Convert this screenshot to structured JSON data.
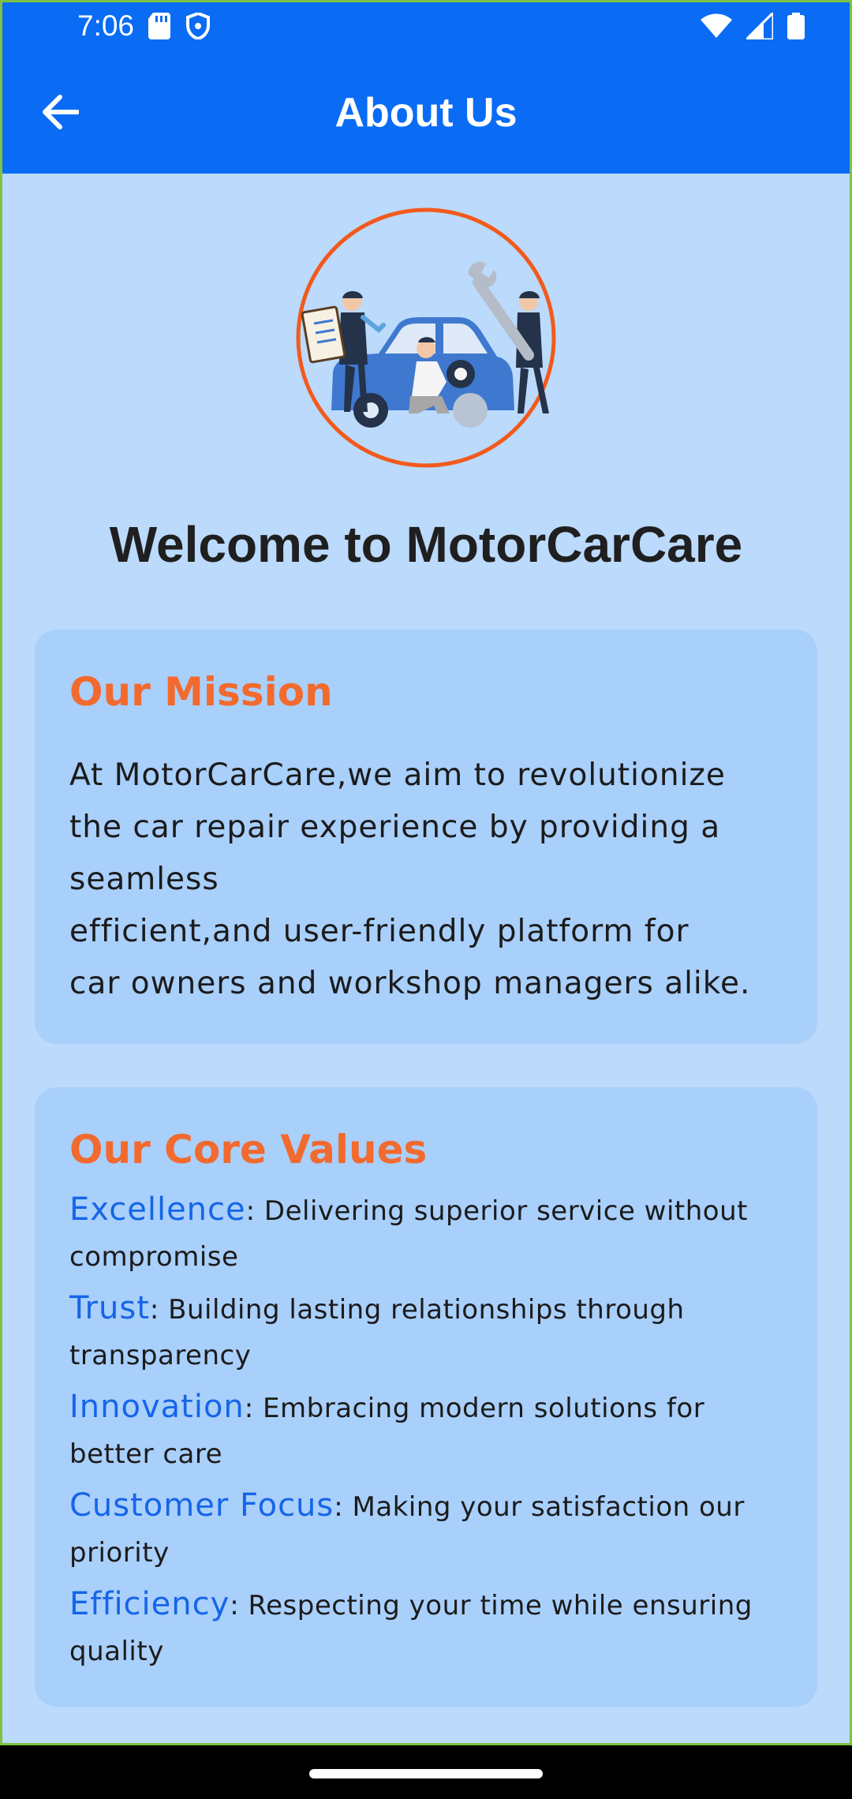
{
  "status_bar": {
    "time": "7:06",
    "left_icons": [
      "sd-card-icon",
      "shield-icon"
    ],
    "right_icons": [
      "wifi-icon",
      "signal-icon",
      "battery-icon"
    ]
  },
  "app_bar": {
    "back_icon": "arrow-left-icon",
    "title": "About Us"
  },
  "hero": {
    "illustration": "car-repair-illustration",
    "ring_color": "#f25a1d"
  },
  "welcome": {
    "title": "Welcome to MotorCarCare"
  },
  "mission": {
    "title": "Our Mission",
    "lines": [
      "At MotorCarCare,we aim to revolutionize",
      "the car repair experience by providing a",
      "seamless",
      "efficient,and user-friendly platform for",
      "car owners and workshop managers alike."
    ]
  },
  "values": {
    "title": "Our Core Values",
    "items": [
      {
        "name": "Excellence",
        "desc": ": Delivering superior service without compromise"
      },
      {
        "name": "Trust",
        "desc": ": Building lasting relationships through transparency"
      },
      {
        "name": "Innovation",
        "desc": ": Embracing modern solutions for better care"
      },
      {
        "name": "Customer Focus",
        "desc": ": Making your satisfaction our priority"
      },
      {
        "name": "Efficiency",
        "desc": ": Respecting your time while ensuring quality"
      }
    ]
  },
  "colors": {
    "app_bar": "#0a6cf5",
    "background": "#bbdafc",
    "card": "#a9cffb",
    "heading_orange": "#f26a2e",
    "value_blue": "#1565e8"
  }
}
